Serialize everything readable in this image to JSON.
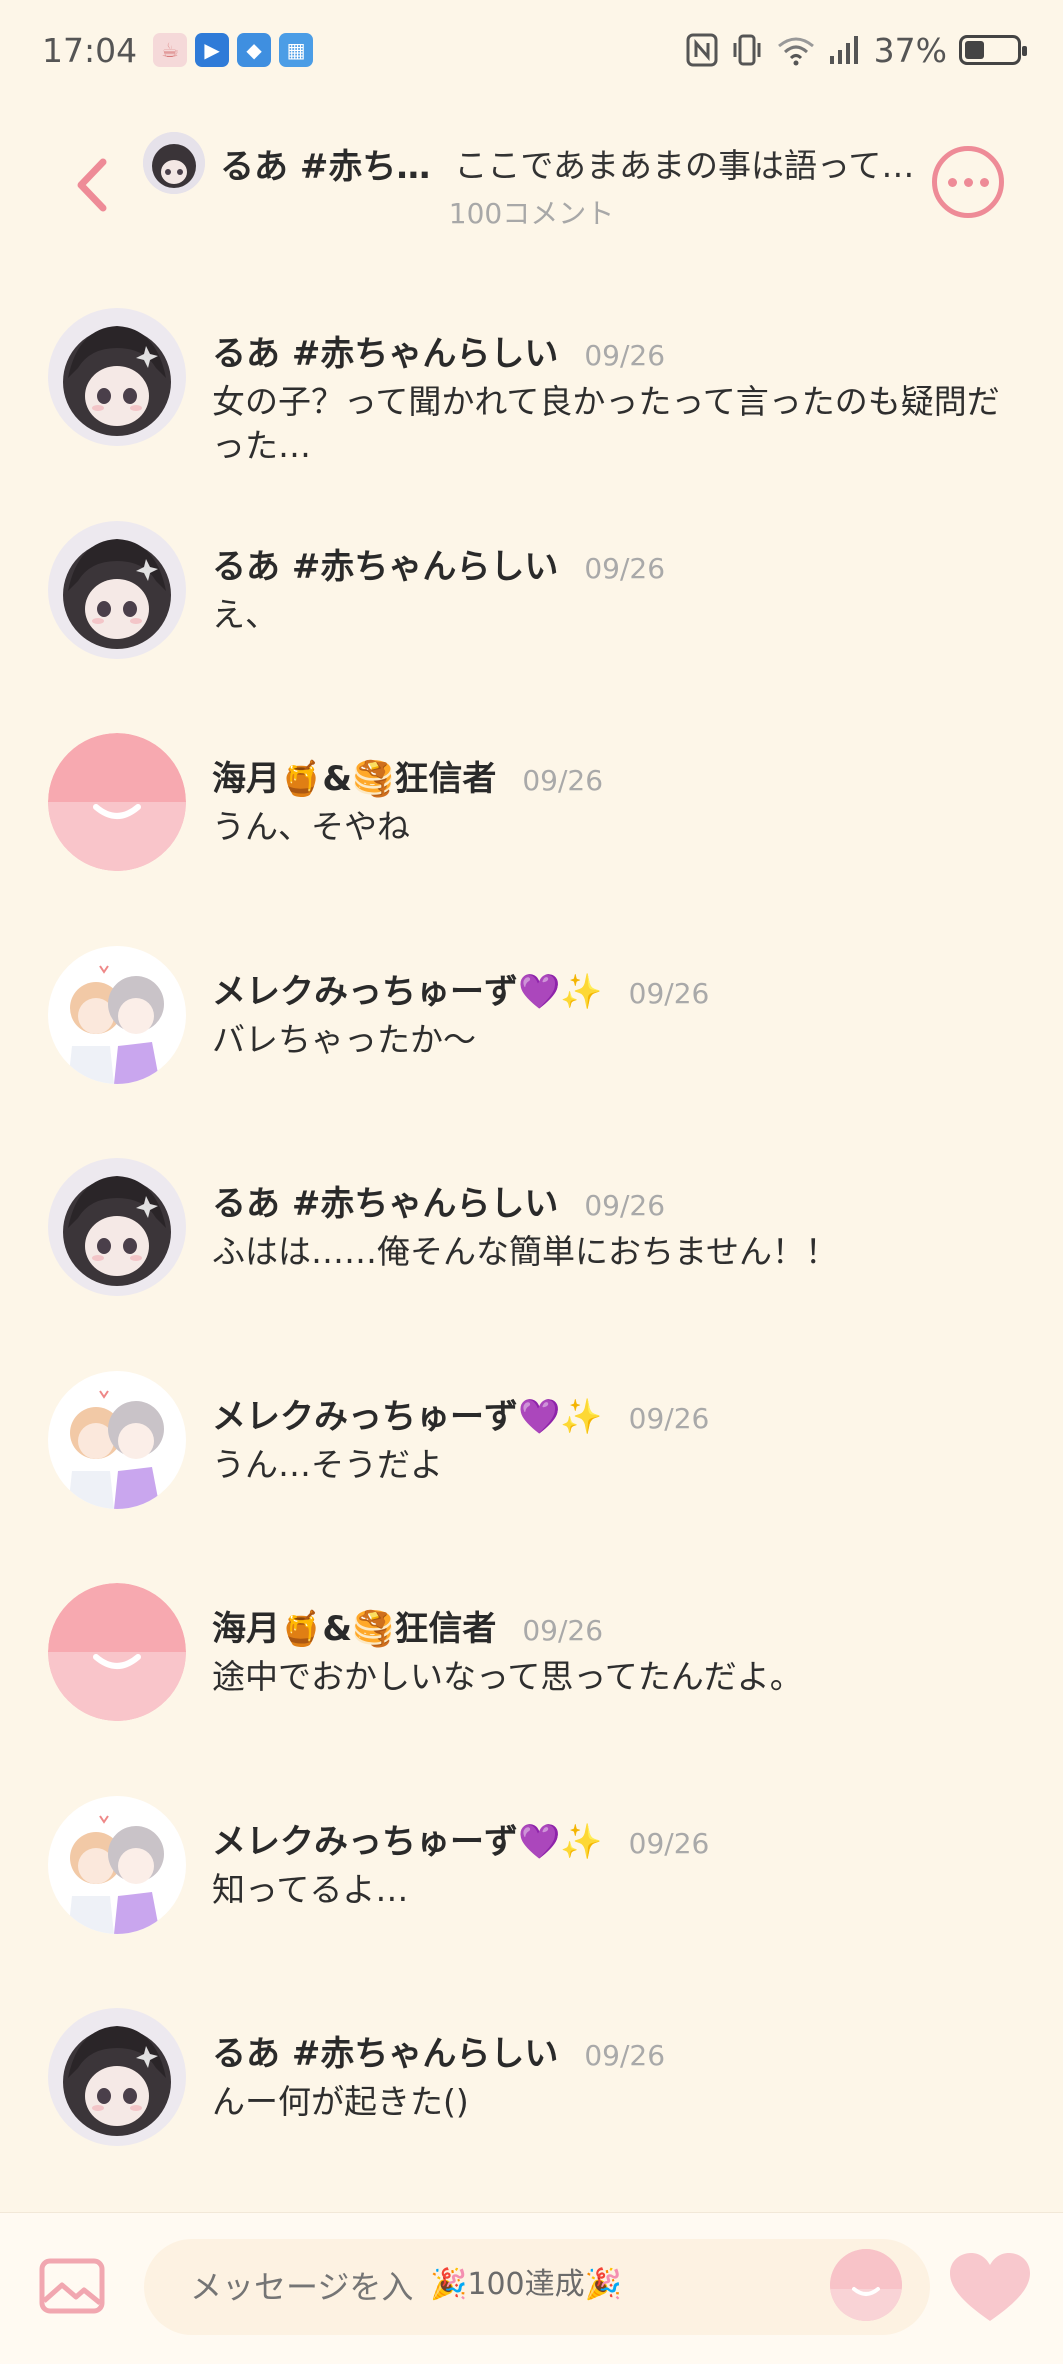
{
  "status_bar": {
    "time": "17:04",
    "battery_text": "37%",
    "battery_level": 0.37,
    "app_icons": [
      "tea-cup-icon",
      "video-play-icon",
      "bookmark-app-icon",
      "calendar-app-icon"
    ],
    "system_icons": [
      "nfc-icon",
      "vibrate-icon",
      "wifi-icon",
      "signal-icon"
    ]
  },
  "header": {
    "back_icon": "chevron-left-icon",
    "user": "るあ #赤ち…",
    "topic": "ここであまあまの事は語って…",
    "comment_count": "100コメント",
    "more_icon": "more-dots-icon",
    "accent_color": "#ee8b97"
  },
  "comments": [
    {
      "name": "るあ #赤ちゃんらしい",
      "date": "09/26",
      "text": "女の子？って聞かれて良かったって言ったのも疑問だった…",
      "avatar": "dark"
    },
    {
      "name": "るあ #赤ちゃんらしい",
      "date": "09/26",
      "text": "え、",
      "avatar": "dark"
    },
    {
      "name": "海月🍯&🥞狂信者",
      "date": "09/26",
      "text": "うん、そやね",
      "avatar": "pink"
    },
    {
      "name": "メレクみっちゅーず💜✨",
      "date": "09/26",
      "text": "バレちゃったか〜",
      "avatar": "couple"
    },
    {
      "name": "るあ #赤ちゃんらしい",
      "date": "09/26",
      "text": "ふはは……俺そんな簡単におちません！！",
      "avatar": "dark"
    },
    {
      "name": "メレクみっちゅーず💜✨",
      "date": "09/26",
      "text": "うん…そうだよ",
      "avatar": "couple"
    },
    {
      "name": "海月🍯&🥞狂信者",
      "date": "09/26",
      "text": "途中でおかしいなって思ってたんだよ。",
      "avatar": "pink"
    },
    {
      "name": "メレクみっちゅーず💜✨",
      "date": "09/26",
      "text": "知ってるよ…",
      "avatar": "couple"
    },
    {
      "name": "るあ #赤ちゃんらしい",
      "date": "09/26",
      "text": "んー何が起きた()",
      "avatar": "dark"
    }
  ],
  "input_bar": {
    "placeholder": "メッセージを入",
    "badge": "🎉100達成🎉",
    "image_icon": "image-icon",
    "sticker_icon": "smiley-sticker-icon",
    "like_icon": "heart-icon"
  }
}
